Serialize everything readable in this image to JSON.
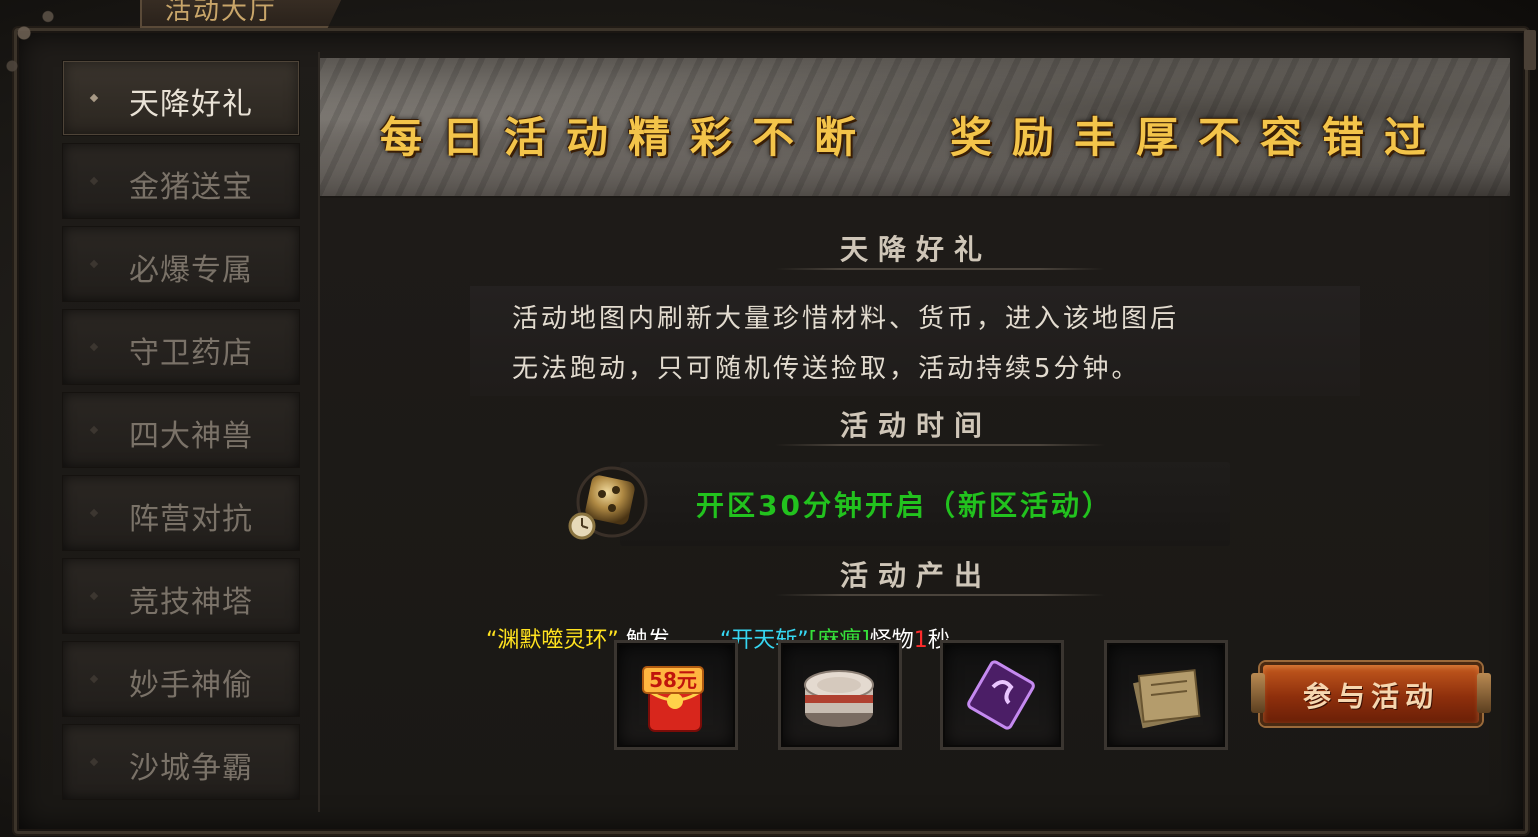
{
  "window": {
    "title": "活动大厅"
  },
  "sidebar": {
    "items": [
      {
        "label": "天降好礼",
        "active": true
      },
      {
        "label": "金猪送宝",
        "active": false
      },
      {
        "label": "必爆专属",
        "active": false
      },
      {
        "label": "守卫药店",
        "active": false
      },
      {
        "label": "四大神兽",
        "active": false
      },
      {
        "label": "阵营对抗",
        "active": false
      },
      {
        "label": "竞技神塔",
        "active": false
      },
      {
        "label": "妙手神偷",
        "active": false
      },
      {
        "label": "沙城争霸",
        "active": false
      }
    ]
  },
  "banner": {
    "left_text": "每日活动精彩不断",
    "right_text": "奖励丰厚不容错过"
  },
  "activity": {
    "title": "天降好礼",
    "description": [
      "活动地图内刷新大量珍惜材料、货币，进入该地图后",
      "无法跑动，只可随机传送捡取，活动持续5分钟。"
    ],
    "time_heading": "活动时间",
    "time_text": "开区30分钟开启（新区活动）",
    "output_heading": "活动产出",
    "trigger": {
      "part1": "“渊默噬灵环”",
      "part2": "触发，",
      "part3": "“开天斩”",
      "part4": "[麻痹]",
      "part5": "怪物",
      "part6": "1",
      "part7": "秒"
    },
    "rewards": [
      {
        "icon": "red-envelope-icon",
        "label": "58元"
      },
      {
        "icon": "can-icon"
      },
      {
        "icon": "purple-gem-card-icon"
      },
      {
        "icon": "scroll-paper-icon"
      }
    ],
    "join_button": "参与活动"
  },
  "colors": {
    "banner_gold": "#f3c44a",
    "time_green": "#22c21e",
    "trigger_yellow": "#ffe21f",
    "trigger_cyan": "#36d7f2",
    "trigger_green": "#36e03a",
    "trigger_red": "#ff2b2b"
  }
}
